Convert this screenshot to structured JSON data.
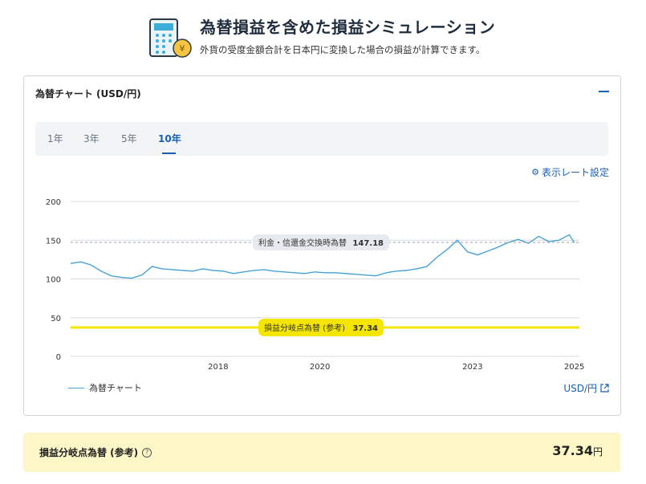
{
  "header": {
    "title": "為替損益を含めた損益シミュレーション",
    "subtitle": "外貨の受度金額合計を日本円に変換した場合の損益が計算できます。",
    "icon": "calculator-yen-icon"
  },
  "chart_card": {
    "title": "為替チャート (USD/円)",
    "tabs": [
      "1年",
      "3年",
      "5年",
      "10年"
    ],
    "active_tab": "10年",
    "rate_settings_label": "表示レート設定",
    "legend_label": "為替チャート",
    "unit_label": "USD/円",
    "colors": {
      "line": "#4aa3d4",
      "breakeven": "#f5e600",
      "accent": "#1a5fb4"
    }
  },
  "chart_data": {
    "type": "line",
    "title": "",
    "xlabel": "",
    "ylabel": "",
    "ylim": [
      0,
      200
    ],
    "xlim": [
      2015.1,
      2025.1
    ],
    "yticks": [
      0,
      50,
      100,
      150,
      200
    ],
    "xticks": [
      "2018",
      "2020",
      "2023",
      "2025"
    ],
    "series": [
      {
        "name": "為替チャート",
        "x": [
          2015.1,
          2015.3,
          2015.5,
          2015.7,
          2015.9,
          2016.1,
          2016.3,
          2016.5,
          2016.7,
          2016.9,
          2017.1,
          2017.3,
          2017.5,
          2017.7,
          2017.9,
          2018.1,
          2018.3,
          2018.5,
          2018.7,
          2018.9,
          2019.1,
          2019.3,
          2019.5,
          2019.7,
          2019.9,
          2020.1,
          2020.3,
          2020.5,
          2020.7,
          2020.9,
          2021.1,
          2021.3,
          2021.5,
          2021.7,
          2021.9,
          2022.1,
          2022.3,
          2022.5,
          2022.7,
          2022.9,
          2023.1,
          2023.3,
          2023.5,
          2023.7,
          2023.9,
          2024.1,
          2024.3,
          2024.5,
          2024.7,
          2024.9,
          2025.0
        ],
        "y": [
          120,
          122,
          118,
          110,
          104,
          102,
          101,
          105,
          116,
          113,
          112,
          111,
          110,
          113,
          111,
          110,
          107,
          109,
          111,
          112,
          110,
          109,
          108,
          107,
          109,
          108,
          108,
          107,
          106,
          105,
          104,
          108,
          110,
          111,
          113,
          116,
          128,
          138,
          150,
          135,
          131,
          136,
          141,
          147,
          151,
          146,
          155,
          148,
          150,
          157,
          147
        ]
      }
    ],
    "reference_lines": [
      {
        "label": "利金・信還金交換時為替",
        "value": 147.18,
        "value_label": "147.18",
        "style": "dashed"
      },
      {
        "label": "損益分岐点為替 (参考)",
        "value": 37.34,
        "value_label": "37.34",
        "style": "solid"
      }
    ],
    "legend": "bottom-left",
    "grid": "horizontal"
  },
  "summary": {
    "label": "損益分岐点為替 (参考)",
    "value": "37.34",
    "unit": "円"
  }
}
